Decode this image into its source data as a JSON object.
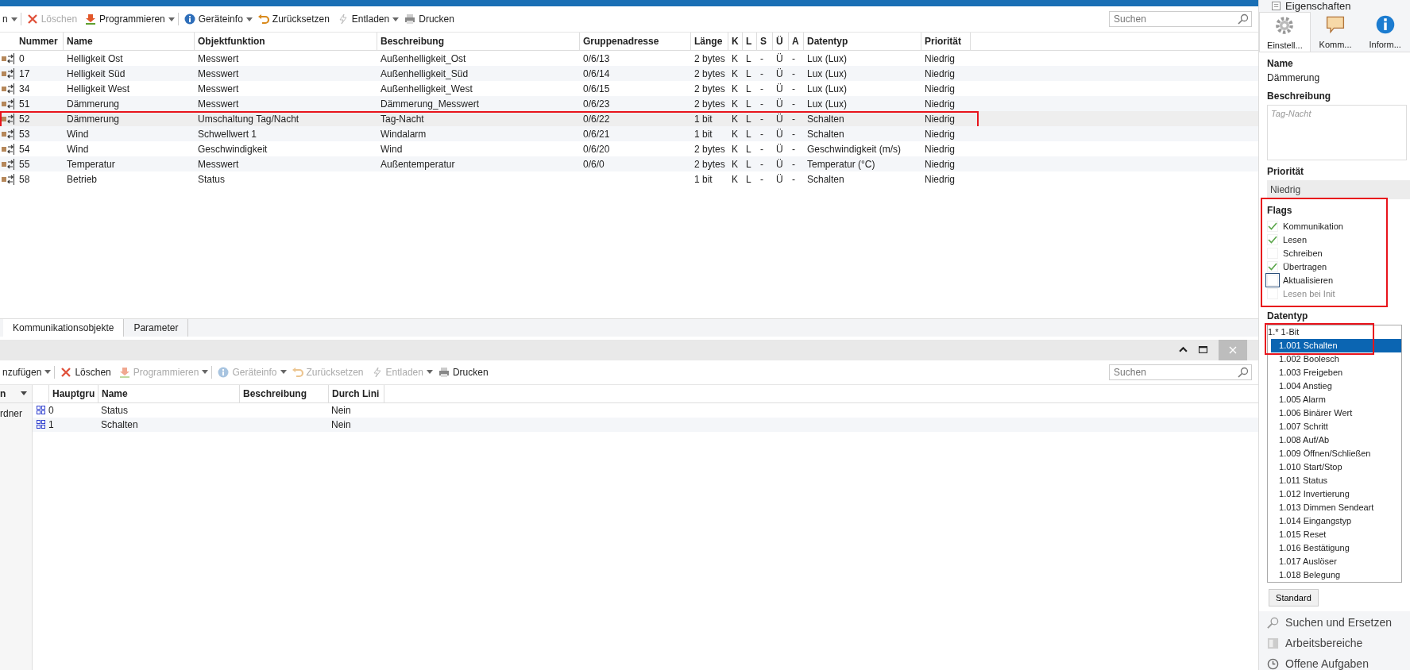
{
  "toolbar": [
    {
      "label": "n",
      "kind": "plain",
      "disabled": false,
      "dropdown": true
    },
    {
      "label": "Löschen",
      "kind": "delete",
      "disabled": true,
      "dropdown": false
    },
    {
      "label": "Programmieren",
      "kind": "program",
      "disabled": false,
      "dropdown": true
    },
    {
      "label": "Geräteinfo",
      "kind": "info",
      "disabled": false,
      "dropdown": true
    },
    {
      "label": "Zurücksetzen",
      "kind": "reset",
      "disabled": false,
      "dropdown": false
    },
    {
      "label": "Entladen",
      "kind": "unload",
      "disabled": false,
      "dropdown": true
    },
    {
      "label": "Drucken",
      "kind": "print",
      "disabled": false,
      "dropdown": false
    }
  ],
  "search": {
    "placeholder": "Suchen"
  },
  "table": {
    "columns": [
      "Nummer",
      "Name",
      "Objektfunktion",
      "Beschreibung",
      "Gruppenadresse",
      "Länge",
      "K",
      "L",
      "S",
      "Ü",
      "A",
      "Datentyp",
      "Priorität"
    ],
    "rows": [
      {
        "selected": false,
        "annotated": false,
        "cells": [
          "0",
          "Helligkeit Ost",
          "Messwert",
          "Außenhelligkeit_Ost",
          "0/6/13",
          "2 bytes",
          "K",
          "L",
          "-",
          "Ü",
          "-",
          "Lux (Lux)",
          "Niedrig"
        ]
      },
      {
        "selected": false,
        "annotated": false,
        "cells": [
          "17",
          "Helligkeit Süd",
          "Messwert",
          "Außenhelligkeit_Süd",
          "0/6/14",
          "2 bytes",
          "K",
          "L",
          "-",
          "Ü",
          "-",
          "Lux (Lux)",
          "Niedrig"
        ]
      },
      {
        "selected": false,
        "annotated": false,
        "cells": [
          "34",
          "Helligkeit West",
          "Messwert",
          "Außenhelligkeit_West",
          "0/6/15",
          "2 bytes",
          "K",
          "L",
          "-",
          "Ü",
          "-",
          "Lux (Lux)",
          "Niedrig"
        ]
      },
      {
        "selected": false,
        "annotated": false,
        "cells": [
          "51",
          "Dämmerung",
          "Messwert",
          "Dämmerung_Messwert",
          "0/6/23",
          "2 bytes",
          "K",
          "L",
          "-",
          "Ü",
          "-",
          "Lux (Lux)",
          "Niedrig"
        ]
      },
      {
        "selected": true,
        "annotated": true,
        "cells": [
          "52",
          "Dämmerung",
          "Umschaltung Tag/Nacht",
          "Tag-Nacht",
          "0/6/22",
          "1 bit",
          "K",
          "L",
          "-",
          "Ü",
          "-",
          "Schalten",
          "Niedrig"
        ]
      },
      {
        "selected": false,
        "annotated": false,
        "cells": [
          "53",
          "Wind",
          "Schwellwert 1",
          "Windalarm",
          "0/6/21",
          "1 bit",
          "K",
          "L",
          "-",
          "Ü",
          "-",
          "Schalten",
          "Niedrig"
        ]
      },
      {
        "selected": false,
        "annotated": false,
        "cells": [
          "54",
          "Wind",
          "Geschwindigkeit",
          "Wind",
          "0/6/20",
          "2 bytes",
          "K",
          "L",
          "-",
          "Ü",
          "-",
          "Geschwindigkeit (m/s)",
          "Niedrig"
        ]
      },
      {
        "selected": false,
        "annotated": false,
        "cells": [
          "55",
          "Temperatur",
          "Messwert",
          "Außentemperatur",
          "0/6/0",
          "2 bytes",
          "K",
          "L",
          "-",
          "Ü",
          "-",
          "Temperatur (°C)",
          "Niedrig"
        ]
      },
      {
        "selected": false,
        "annotated": false,
        "cells": [
          "58",
          "Betrieb",
          "Status",
          "",
          "",
          "1 bit",
          "K",
          "L",
          "-",
          "Ü",
          "-",
          "Schalten",
          "Niedrig"
        ]
      }
    ]
  },
  "tabs": [
    {
      "label": "Kommunikationsobjekte",
      "selected": true
    },
    {
      "label": "Parameter",
      "selected": false
    }
  ],
  "bottom_toolbar": [
    {
      "label": "nzufügen",
      "kind": "plain",
      "disabled": false,
      "dropdown": true
    },
    {
      "label": "Löschen",
      "kind": "delete",
      "disabled": false,
      "dropdown": false
    },
    {
      "label": "Programmieren",
      "kind": "program",
      "disabled": true,
      "dropdown": true
    },
    {
      "label": "Geräteinfo",
      "kind": "info",
      "disabled": true,
      "dropdown": true
    },
    {
      "label": "Zurücksetzen",
      "kind": "reset",
      "disabled": true,
      "dropdown": false
    },
    {
      "label": "Entladen",
      "kind": "unload",
      "disabled": true,
      "dropdown": true
    },
    {
      "label": "Drucken",
      "kind": "print",
      "disabled": false,
      "dropdown": false
    }
  ],
  "bottom_search": {
    "placeholder": "Suchen"
  },
  "folder_tree": {
    "header": "n",
    "items": [
      "rdner"
    ]
  },
  "group_table": {
    "columns": [
      "Hauptgru",
      "Name",
      "Beschreibung",
      "Durch Lini"
    ],
    "rows": [
      {
        "cells": [
          "0",
          "Status",
          "",
          "Nein"
        ]
      },
      {
        "cells": [
          "1",
          "Schalten",
          "",
          "Nein"
        ]
      }
    ]
  },
  "properties": {
    "title": "Eigenschaften",
    "tabs": [
      {
        "label": "Einstell...",
        "kind": "gear",
        "selected": true
      },
      {
        "label": "Komm...",
        "kind": "comment",
        "selected": false
      },
      {
        "label": "Inform...",
        "kind": "info",
        "selected": false
      }
    ],
    "name_label": "Name",
    "name": "Dämmerung",
    "description_label": "Beschreibung",
    "description": "Tag-Nacht",
    "priority_label": "Priorität",
    "priority": "Niedrig",
    "flags_label": "Flags",
    "flags_annotated": true,
    "flags": [
      {
        "label": "Kommunikation",
        "checked": true,
        "disabled": false
      },
      {
        "label": "Lesen",
        "checked": true,
        "disabled": false
      },
      {
        "label": "Schreiben",
        "checked": false,
        "disabled": false
      },
      {
        "label": "Übertragen",
        "checked": true,
        "disabled": false
      },
      {
        "label": "Aktualisieren",
        "checked": false,
        "disabled": false,
        "focused": true
      },
      {
        "label": "Lesen bei Init",
        "checked": false,
        "disabled": true
      }
    ],
    "datatype_label": "Datentyp",
    "datatype_annotated": true,
    "datatypes": [
      {
        "label": "1.* 1-Bit",
        "children": [
          {
            "label": "1.001 Schalten",
            "selected": true
          },
          {
            "label": "1.002 Boolesch",
            "selected": false
          },
          {
            "label": "1.003 Freigeben",
            "selected": false
          },
          {
            "label": "1.004 Anstieg",
            "selected": false
          },
          {
            "label": "1.005 Alarm",
            "selected": false
          },
          {
            "label": "1.006 Binärer Wert",
            "selected": false
          },
          {
            "label": "1.007 Schritt",
            "selected": false
          },
          {
            "label": "1.008 Auf/Ab",
            "selected": false
          },
          {
            "label": "1.009 Öffnen/Schließen",
            "selected": false
          },
          {
            "label": "1.010 Start/Stop",
            "selected": false
          },
          {
            "label": "1.011 Status",
            "selected": false
          },
          {
            "label": "1.012 Invertierung",
            "selected": false
          },
          {
            "label": "1.013 Dimmen Sendeart",
            "selected": false
          },
          {
            "label": "1.014 Eingangstyp",
            "selected": false
          },
          {
            "label": "1.015 Reset",
            "selected": false
          },
          {
            "label": "1.016 Bestätigung",
            "selected": false
          },
          {
            "label": "1.017 Auslöser",
            "selected": false
          },
          {
            "label": "1.018 Belegung",
            "selected": false
          }
        ]
      }
    ],
    "standard_button": "Standard",
    "side_links": [
      {
        "label": "Suchen und Ersetzen",
        "kind": "search"
      },
      {
        "label": "Arbeitsbereiche",
        "kind": "workspace"
      },
      {
        "label": "Offene Aufgaben",
        "kind": "clock"
      }
    ]
  }
}
